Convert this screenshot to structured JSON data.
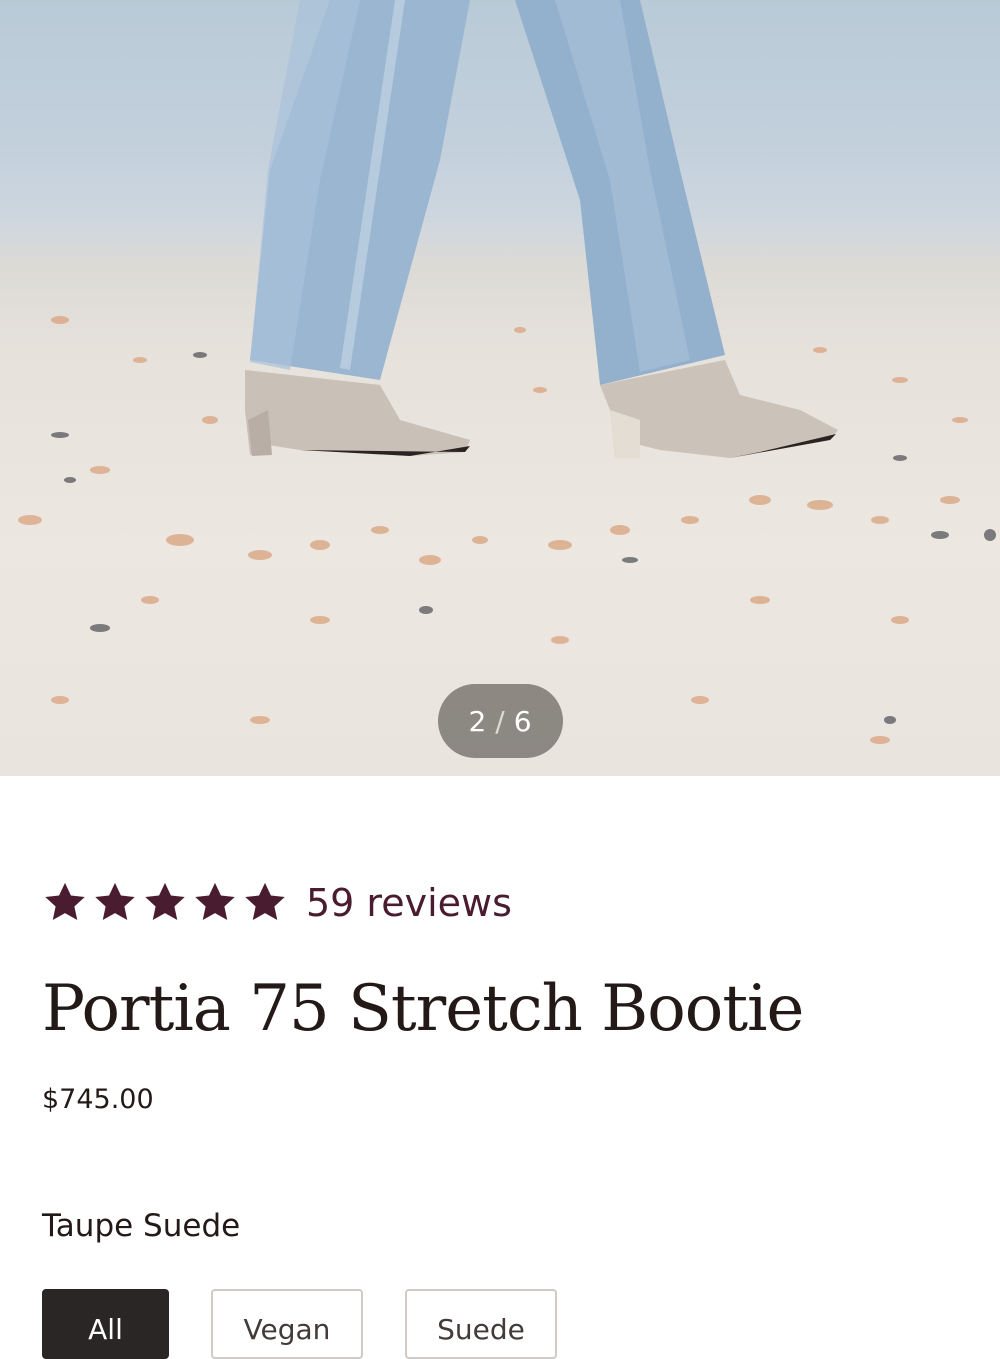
{
  "gallery": {
    "current": "2",
    "separator": "/",
    "total": "6"
  },
  "rating": {
    "stars": 5,
    "max_stars": 5,
    "reviews_label": "59 reviews",
    "star_color": "#4a1c30"
  },
  "product": {
    "title": "Portia 75 Stretch Bootie",
    "price": "$745.00",
    "color_name": "Taupe Suede"
  },
  "filters": [
    {
      "label": "All",
      "active": true
    },
    {
      "label": "Vegan",
      "active": false
    },
    {
      "label": "Suede",
      "active": false
    }
  ]
}
